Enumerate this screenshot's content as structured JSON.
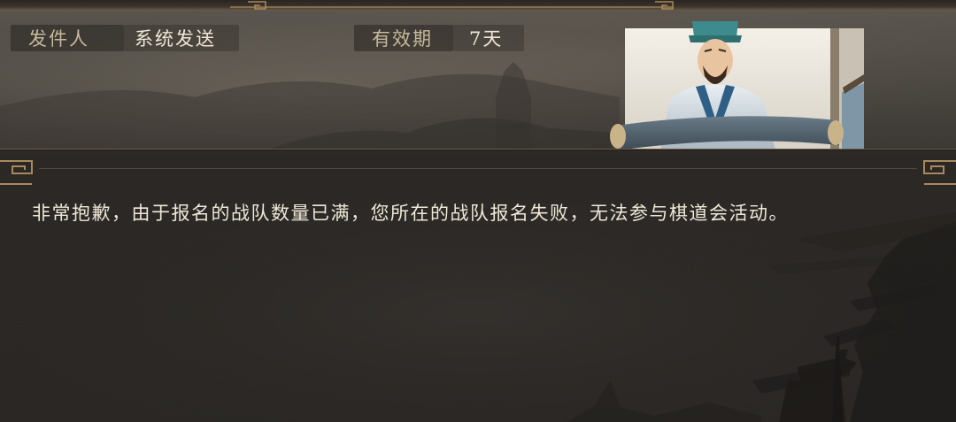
{
  "mail": {
    "sender_label": "发件人",
    "sender_value": "系统发送",
    "validity_label": "有效期",
    "validity_value": "7天",
    "body": "非常抱歉，由于报名的战队数量已满，您所在的战队报名失败，无法参与棋道会活动。"
  },
  "colors": {
    "label": "#c8b99c",
    "value": "#efe7d6",
    "gold_ornament": "#a98a5c",
    "background": "#2a2724"
  },
  "icons": {
    "header_ornament": "gold-fret-ornament",
    "corner_ornament": "gold-scroll-ornament"
  }
}
